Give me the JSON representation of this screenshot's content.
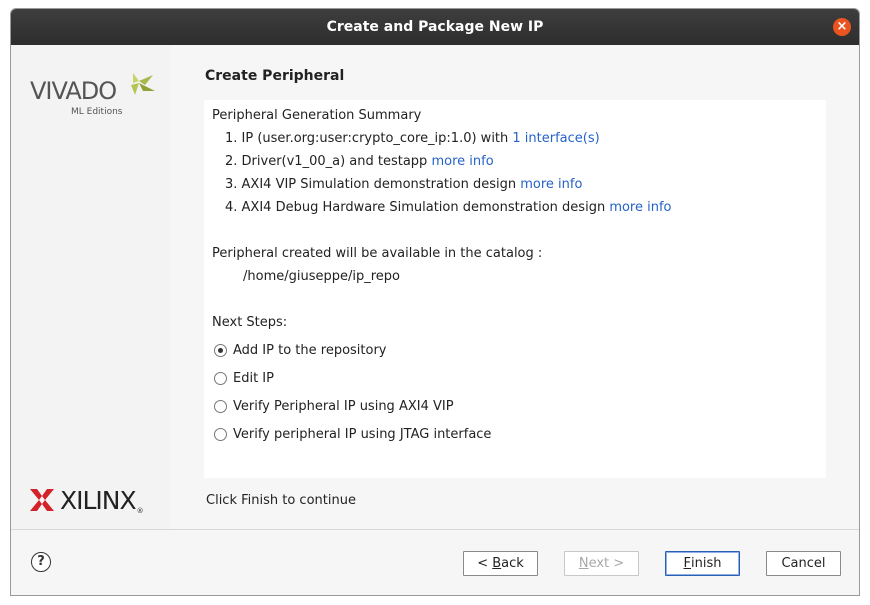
{
  "window": {
    "title": "Create and Package New IP",
    "close_glyph": "×"
  },
  "branding": {
    "vivado_name": "VIVADO",
    "vivado_edition": "ML Editions",
    "xilinx_name": "XILINX",
    "xilinx_reg": "®",
    "colors": {
      "vivado_leaf": "#a8b84a",
      "xilinx_mark": "#d2232a"
    }
  },
  "page": {
    "title": "Create Peripheral",
    "summary_heading": "Peripheral Generation Summary",
    "summary_items": [
      {
        "text": "1. IP (user.org:user:crypto_core_ip:1.0) with ",
        "link": "1 interface(s)"
      },
      {
        "text": "2. Driver(v1_00_a) and testapp ",
        "link": "more info"
      },
      {
        "text": "3. AXI4 VIP Simulation demonstration design ",
        "link": "more info"
      },
      {
        "text": "4. AXI4 Debug Hardware Simulation demonstration design ",
        "link": "more info"
      }
    ],
    "catalog_label": "Peripheral created will be available in the catalog :",
    "catalog_path": "/home/giuseppe/ip_repo",
    "next_steps_label": "Next Steps:",
    "next_steps": [
      {
        "label": "Add IP to the repository",
        "selected": true
      },
      {
        "label": "Edit IP",
        "selected": false
      },
      {
        "label": "Verify Peripheral IP using AXI4 VIP",
        "selected": false
      },
      {
        "label": "Verify peripheral IP using JTAG interface",
        "selected": false
      }
    ],
    "footer": "Click Finish to continue"
  },
  "buttons": {
    "help": "?",
    "back_prefix": "< ",
    "back_mnemonic": "B",
    "back_rest": "ack",
    "next_mnemonic": "N",
    "next_rest": "ext >",
    "finish_mnemonic": "F",
    "finish_rest": "inish",
    "cancel": "Cancel"
  },
  "colors": {
    "link": "#2563c7",
    "titlebar": "#333333",
    "close": "#e95420"
  }
}
